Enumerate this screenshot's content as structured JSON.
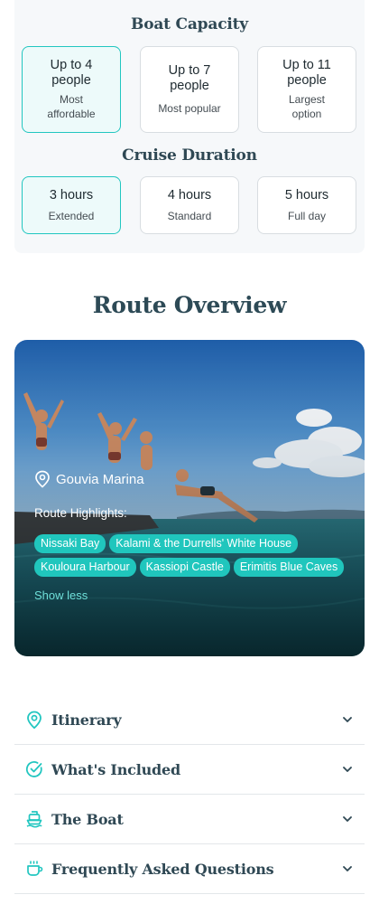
{
  "boat_capacity": {
    "title": "Boat Capacity",
    "options": [
      {
        "main": "Up to 4 people",
        "sub": "Most affordable",
        "selected": true
      },
      {
        "main": "Up to 7 people",
        "sub": "Most popular",
        "selected": false
      },
      {
        "main": "Up to 11 people",
        "sub": "Largest option",
        "selected": false
      }
    ]
  },
  "cruise_duration": {
    "title": "Cruise Duration",
    "options": [
      {
        "main": "3 hours",
        "sub": "Extended",
        "selected": true
      },
      {
        "main": "4 hours",
        "sub": "Standard",
        "selected": false
      },
      {
        "main": "5 hours",
        "sub": "Full day",
        "selected": false
      }
    ]
  },
  "route_overview": {
    "title": "Route Overview",
    "marina": "Gouvia Marina",
    "highlights_label": "Route Highlights:",
    "highlights": [
      "Nissaki Bay",
      "Kalami & the Durrells' White House",
      "Kouloura Harbour",
      "Kassiopi Castle",
      "Erimitis Blue Caves"
    ],
    "toggle_label": "Show less"
  },
  "accordions": [
    {
      "label": "Itinerary",
      "icon": "map-pin-icon"
    },
    {
      "label": "What's Included",
      "icon": "check-circle-icon"
    },
    {
      "label": "The Boat",
      "icon": "ship-icon"
    },
    {
      "label": "Frequently Asked Questions",
      "icon": "coffee-cup-icon"
    }
  ],
  "colors": {
    "accent": "#22c6c0",
    "heading": "#2f4854",
    "chip": "#20c6bd"
  }
}
